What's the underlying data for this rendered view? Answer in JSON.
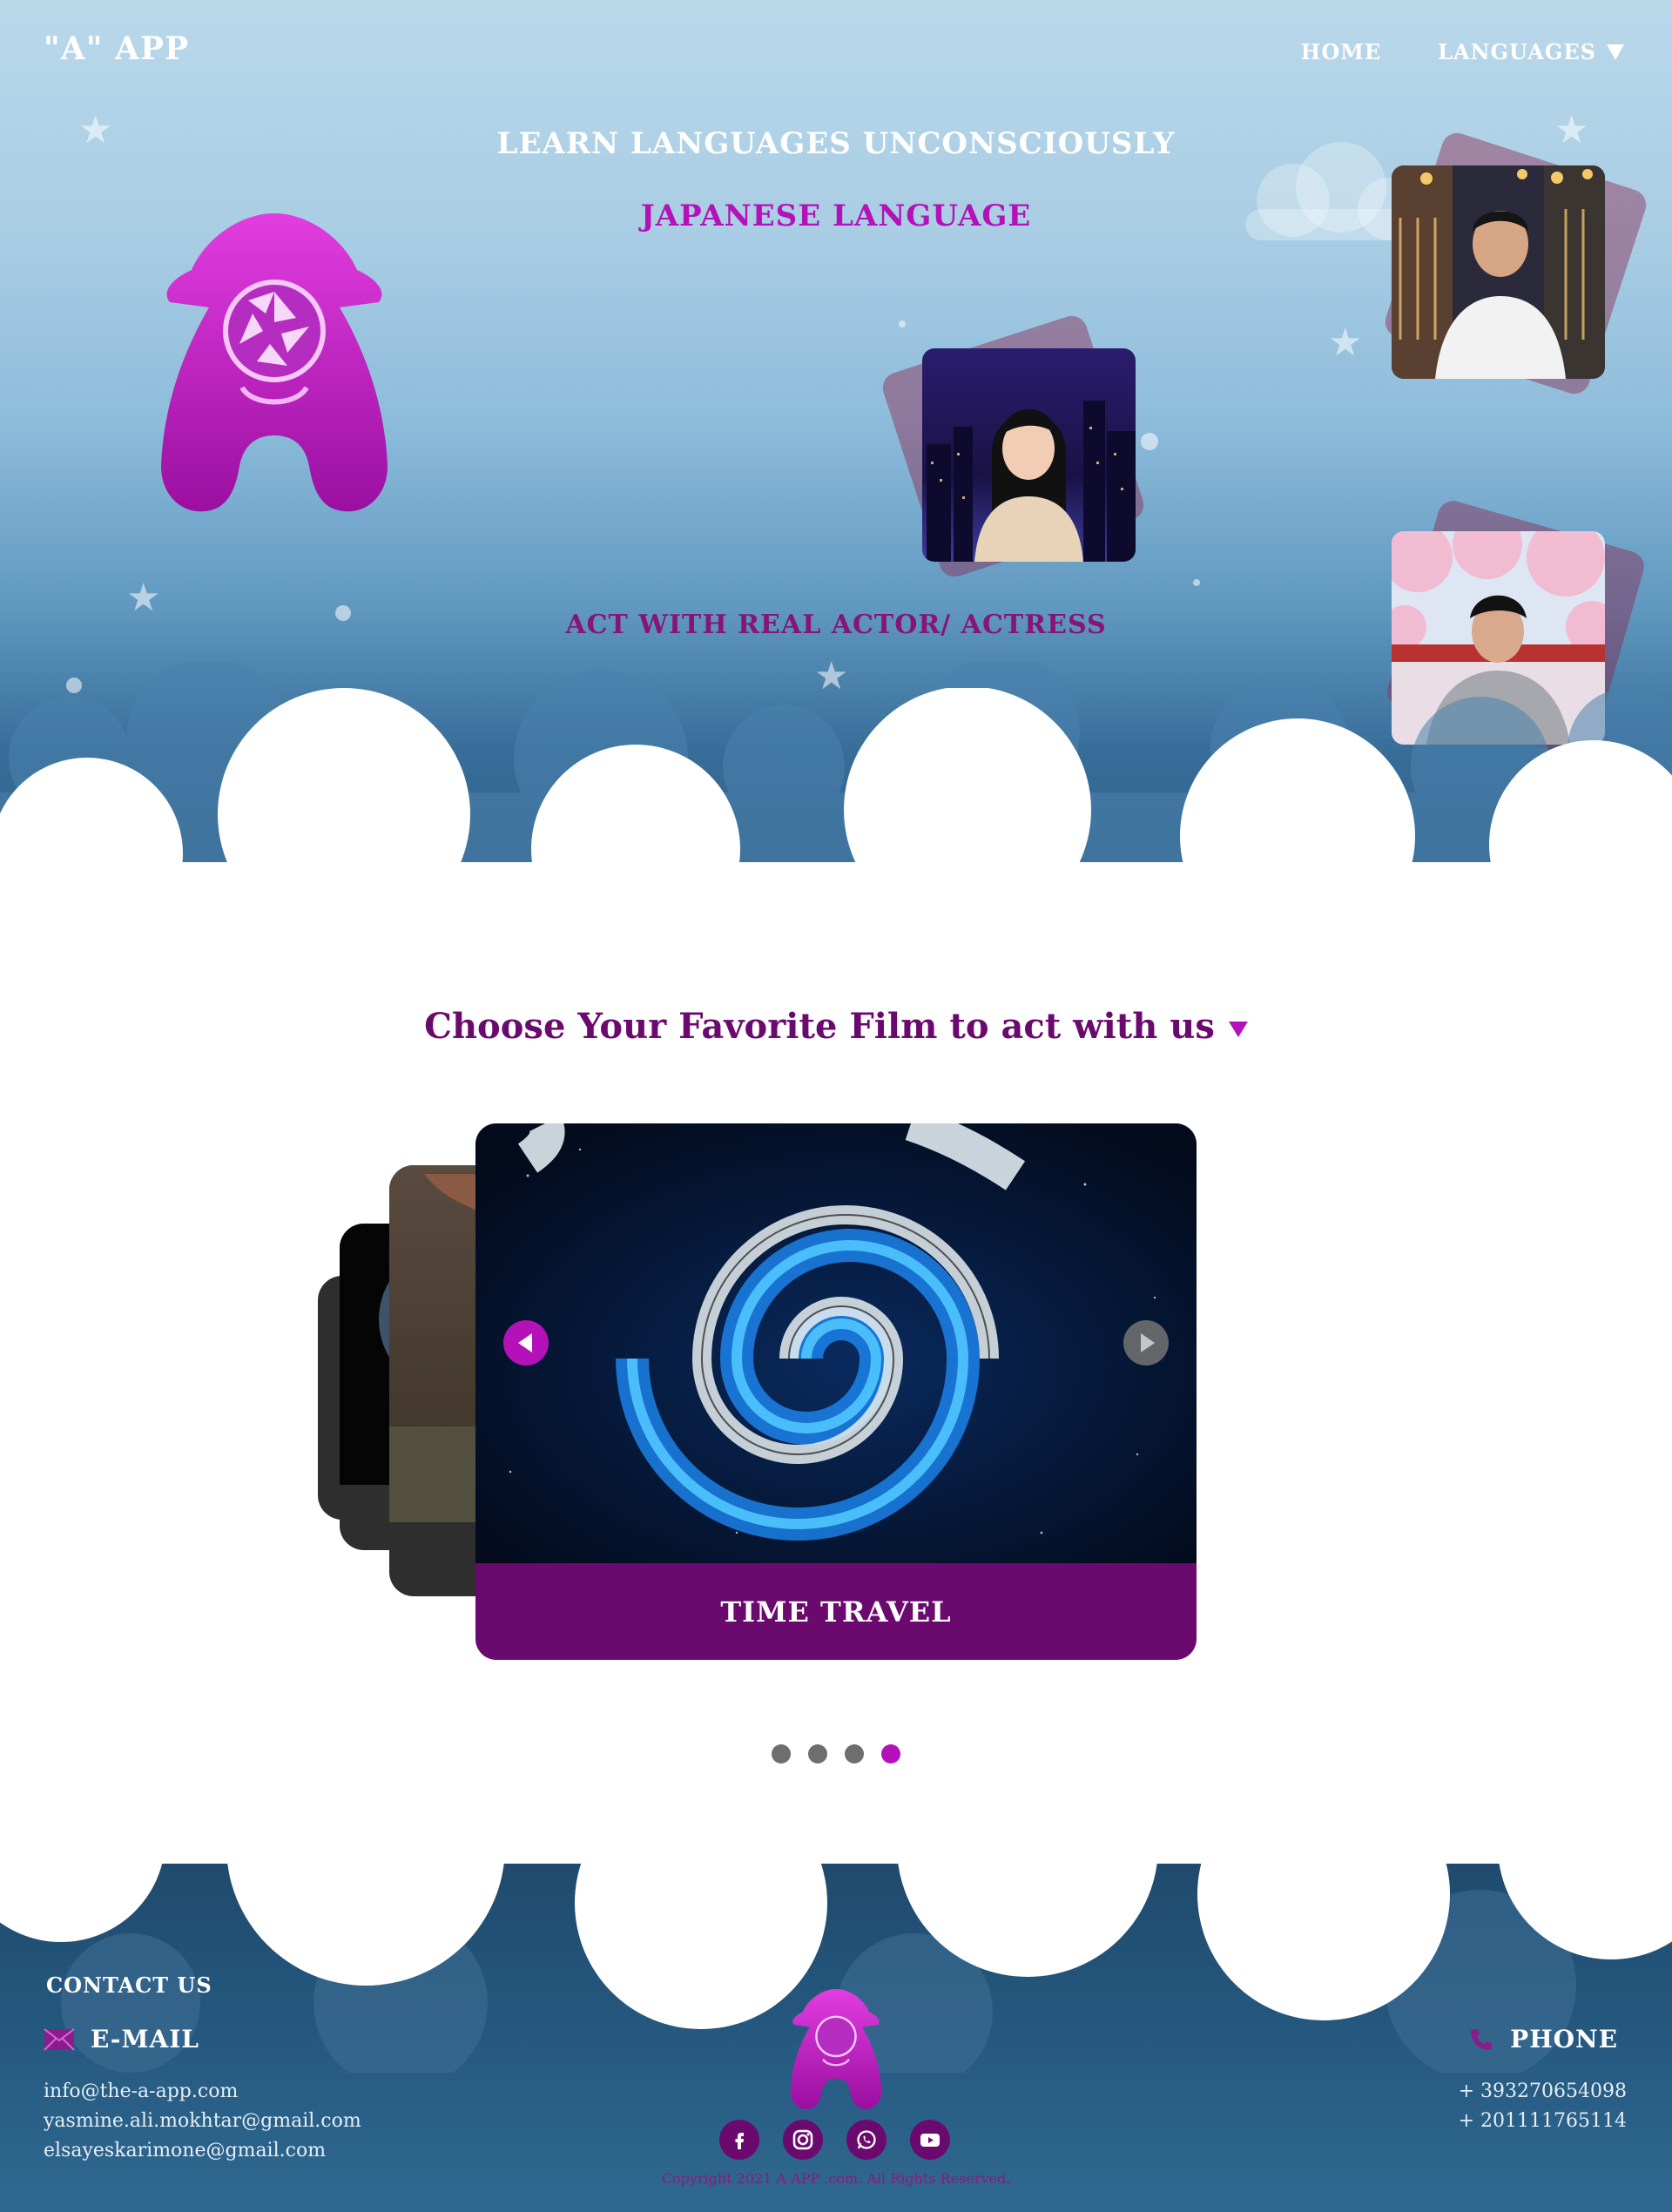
{
  "header": {
    "brand": "\"A\" APP",
    "nav": [
      {
        "label": "HOME"
      },
      {
        "label": "LANGUAGES"
      }
    ]
  },
  "hero": {
    "tagline": "LEARN LANGUAGES UNCONSCIOUSLY",
    "language": "JAPANESE LANGUAGE",
    "act_text": "ACT WITH REAL ACTOR/ ACTRESS"
  },
  "films": {
    "title": "Choose Your Favorite Film to act with us",
    "current_caption": "TIME TRAVEL",
    "dots": 4,
    "active_dot": 4
  },
  "footer": {
    "contact_title": "CONTACT US",
    "email_label": "E-MAIL",
    "emails": [
      "info@the-a-app.com",
      "yasmine.ali.mokhtar@gmail.com",
      "elsayeskarimone@gmail.com"
    ],
    "phone_label": "PHONE",
    "phones": [
      "+ 393270654098",
      "+ 201111765114"
    ],
    "socials": [
      "facebook-icon",
      "instagram-icon",
      "whatsapp-icon",
      "youtube-icon"
    ],
    "copyright": "Copyright 2021 A APP .com. All Rights Reserved."
  },
  "colors": {
    "accent": "#b411b8",
    "deep_purple": "#6b0a6e",
    "sky_top": "#bad8ea",
    "sky_bottom": "#2a5a83"
  }
}
